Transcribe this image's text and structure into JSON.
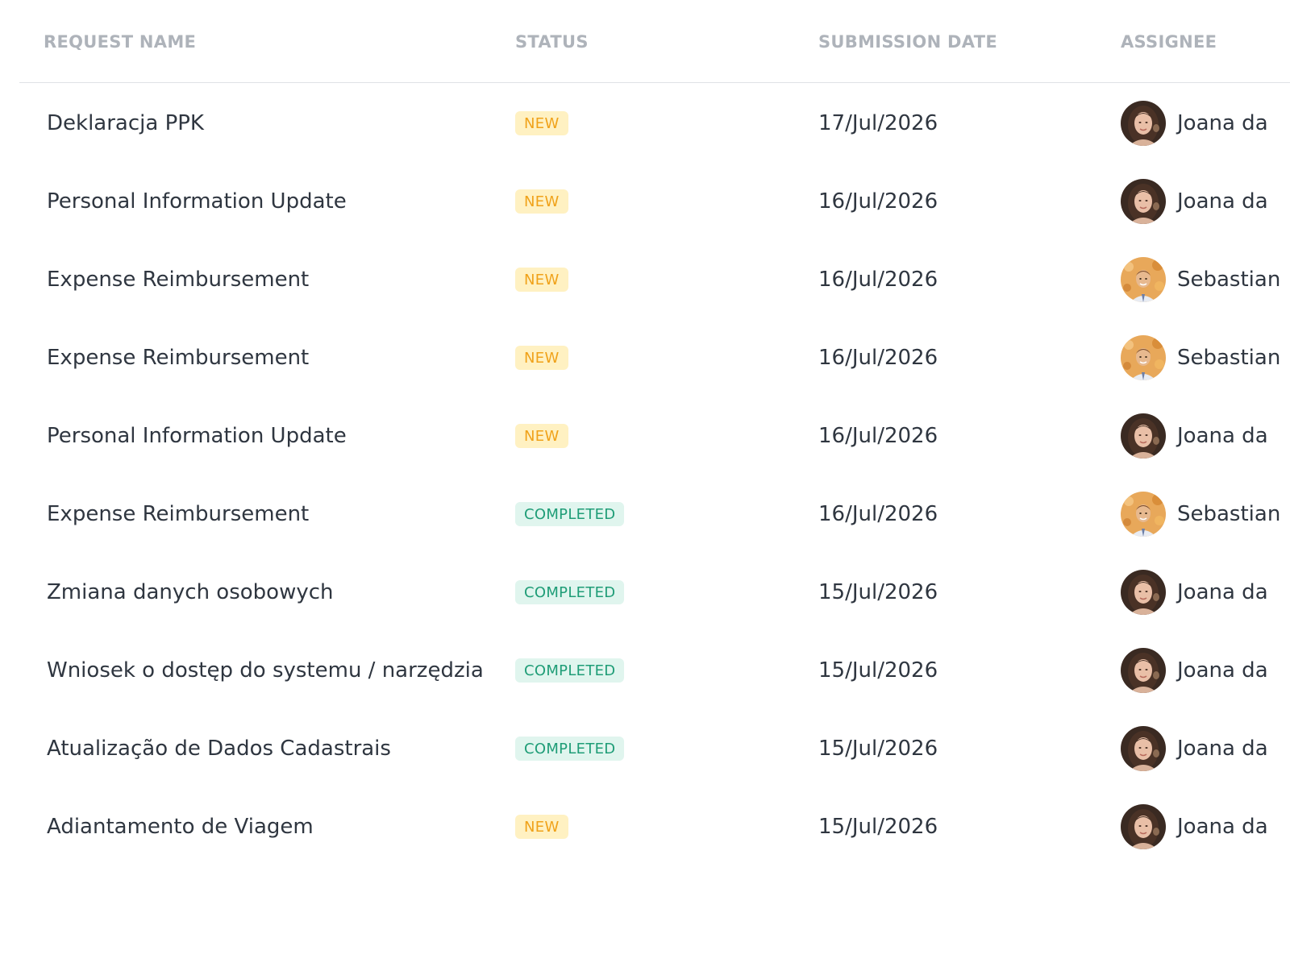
{
  "table": {
    "headers": {
      "request_name": "REQUEST NAME",
      "status": "STATUS",
      "submission_date": "SUBMISSION DATE",
      "assignee": "ASSIGNEE"
    },
    "rows": [
      {
        "name": "Deklaracja PPK",
        "status": "NEW",
        "status_type": "new",
        "date": "17/Jul/2026",
        "assignee": "Joana da",
        "avatar": "joana"
      },
      {
        "name": "Personal Information Update",
        "status": "NEW",
        "status_type": "new",
        "date": "16/Jul/2026",
        "assignee": "Joana da",
        "avatar": "joana"
      },
      {
        "name": "Expense Reimbursement",
        "status": "NEW",
        "status_type": "new",
        "date": "16/Jul/2026",
        "assignee": "Sebastian",
        "avatar": "sebastian"
      },
      {
        "name": "Expense Reimbursement",
        "status": "NEW",
        "status_type": "new",
        "date": "16/Jul/2026",
        "assignee": "Sebastian",
        "avatar": "sebastian"
      },
      {
        "name": "Personal Information Update",
        "status": "NEW",
        "status_type": "new",
        "date": "16/Jul/2026",
        "assignee": "Joana da",
        "avatar": "joana"
      },
      {
        "name": "Expense Reimbursement",
        "status": "COMPLETED",
        "status_type": "completed",
        "date": "16/Jul/2026",
        "assignee": "Sebastian",
        "avatar": "sebastian"
      },
      {
        "name": "Zmiana danych osobowych",
        "status": "COMPLETED",
        "status_type": "completed",
        "date": "15/Jul/2026",
        "assignee": "Joana da",
        "avatar": "joana"
      },
      {
        "name": "Wniosek o dostęp do systemu / narzędzia",
        "status": "COMPLETED",
        "status_type": "completed",
        "date": "15/Jul/2026",
        "assignee": "Joana da",
        "avatar": "joana"
      },
      {
        "name": "Atualização de Dados Cadastrais",
        "status": "COMPLETED",
        "status_type": "completed",
        "date": "15/Jul/2026",
        "assignee": "Joana da",
        "avatar": "joana"
      },
      {
        "name": "Adiantamento de Viagem",
        "status": "NEW",
        "status_type": "new",
        "date": "15/Jul/2026",
        "assignee": "Joana da",
        "avatar": "joana"
      }
    ]
  },
  "colors": {
    "header_text": "#aeb3ba",
    "body_text": "#2f3640",
    "new_badge_bg": "#fff1c2",
    "new_badge_text": "#f0a21a",
    "completed_badge_bg": "#e0f5ee",
    "completed_badge_text": "#1f9d77",
    "divider": "#dfe2e6"
  }
}
